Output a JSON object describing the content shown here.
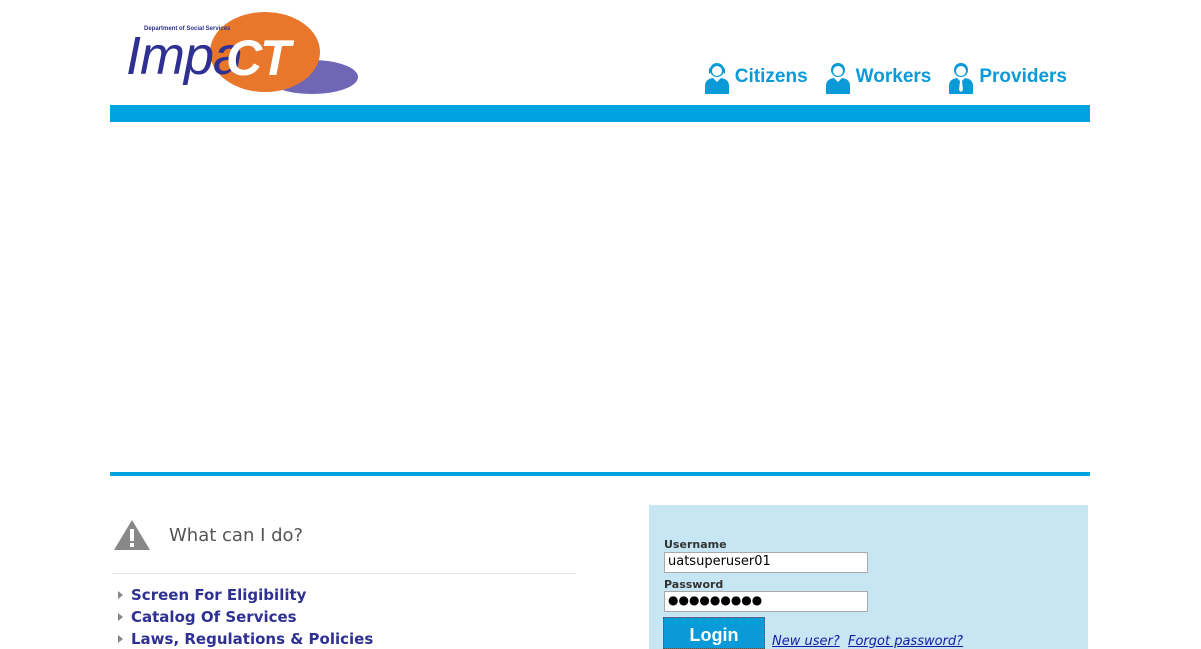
{
  "logo": {
    "department": "Department of Social Services",
    "brand_prefix": "Impa",
    "brand_suffix": "CT"
  },
  "nav": [
    {
      "label": "Citizens",
      "icon": "citizen-icon"
    },
    {
      "label": "Workers",
      "icon": "worker-icon"
    },
    {
      "label": "Providers",
      "icon": "provider-icon"
    }
  ],
  "what_can_i_do": {
    "title": "What can I do?",
    "icon": "warning-icon",
    "links": [
      "Screen For Eligibility",
      "Catalog Of Services",
      "Laws, Regulations & Policies"
    ]
  },
  "login": {
    "username_label": "Username",
    "username_value": "uatsuperuser01",
    "password_label": "Password",
    "password_masked": "●●●●●●●●●",
    "login_button": "Login",
    "new_user": "New user?",
    "forgot_password": "Forgot password?"
  },
  "colors": {
    "accent_blue": "#00a3e0",
    "brand_navy": "#2e3192",
    "brand_orange": "#e8762b",
    "panel_bg": "#c6e6f4"
  }
}
